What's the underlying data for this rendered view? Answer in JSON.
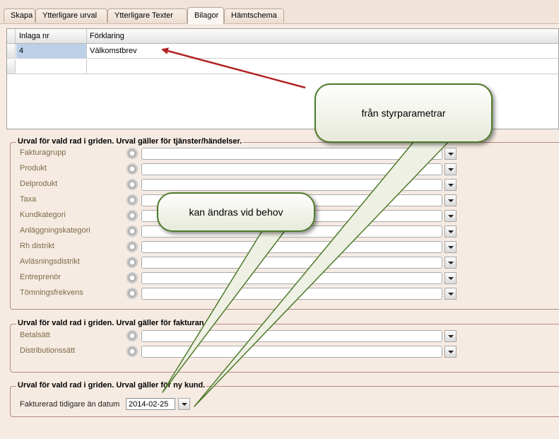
{
  "tabs": [
    {
      "label": "Skapa"
    },
    {
      "label": "Ytterligare urval"
    },
    {
      "label": "Ytterligare Texter"
    },
    {
      "label": "Bilagor",
      "active": true
    },
    {
      "label": "Hämtschema"
    }
  ],
  "grid": {
    "columns": [
      "Inlaga nr",
      "Förklaring"
    ],
    "rows": [
      {
        "inlaga_nr": "4",
        "forklaring": "Välkomstbrev"
      }
    ]
  },
  "group1": {
    "title": "Urval för vald rad i griden. Urval gäller för tjänster/händelser.",
    "fields": [
      "Fakturagrupp",
      "Produkt",
      "Delprodukt",
      "Taxa",
      "Kundkategori",
      "Anläggningskategori",
      "Rh distrikt",
      "Avläsningsdistrikt",
      "Entreprenör",
      "Tömningsfrekvens"
    ]
  },
  "group2": {
    "title": "Urval för vald rad i griden. Urval gäller för fakturan.",
    "fields": [
      "Betalsätt",
      "Distributionssätt"
    ]
  },
  "group3": {
    "title": "Urval för vald rad i griden. Urval gäller för ny kund.",
    "date_label": "Fakturerad tidigare än datum",
    "date_value": "2014-02-25"
  },
  "callouts": {
    "styrparametrar": "från styrparametrar",
    "andras": "kan ändras vid behov"
  },
  "colors": {
    "arrow": "#b22222",
    "callout_border": "#4e7a2a",
    "selected_cell": "#bcd0e8"
  }
}
